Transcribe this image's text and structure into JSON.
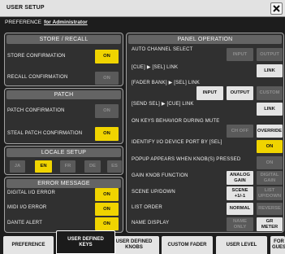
{
  "window": {
    "title": "USER SETUP"
  },
  "icons": {
    "close": "close-icon"
  },
  "colors": {
    "accent_yellow": "#f0d400",
    "active_white": "#e4e4e4",
    "inactive_gray": "#5a5a5a",
    "inactive_text": "#8e8e8e",
    "panel_bg": "#303030",
    "header_bg": "#646464",
    "page_bg": "#1d1d1d",
    "title_bar": "#e2e2e2"
  },
  "preference": {
    "heading": "PREFERENCE",
    "user": "for Administrator"
  },
  "store_recall": {
    "header": "STORE / RECALL",
    "rows": [
      {
        "label": "STORE CONFIRMATION",
        "value": "ON",
        "active": true
      },
      {
        "label": "RECALL CONFIRMATION",
        "value": "ON",
        "active": false
      }
    ]
  },
  "patch": {
    "header": "PATCH",
    "rows": [
      {
        "label": "PATCH CONFIRMATION",
        "value": "ON",
        "active": false
      },
      {
        "label": "STEAL PATCH CONFIRMATION",
        "value": "ON",
        "active": true
      }
    ]
  },
  "locale": {
    "header": "LOCALE SETUP",
    "options": [
      {
        "label": "JA",
        "selected": false
      },
      {
        "label": "EN",
        "selected": true
      },
      {
        "label": "FR",
        "selected": false
      },
      {
        "label": "DE",
        "selected": false
      },
      {
        "label": "ES",
        "selected": false
      }
    ]
  },
  "error_message": {
    "header": "ERROR MESSAGE",
    "rows": [
      {
        "label": "DIGITAL I/O ERROR",
        "value": "ON",
        "active": true
      },
      {
        "label": "MIDI I/O ERROR",
        "value": "ON",
        "active": true
      },
      {
        "label": "DANTE ALERT",
        "value": "ON",
        "active": true
      }
    ]
  },
  "panel_operation": {
    "header": "PANEL OPERATION",
    "rows": [
      {
        "label": "AUTO CHANNEL SELECT",
        "options": [
          {
            "label": "INPUT",
            "active": false
          },
          {
            "label": "OUTPUT",
            "active": false
          }
        ]
      },
      {
        "label": "[CUE] ▶ [SEL] LINK",
        "options": [
          {
            "label": "LINK",
            "active": true
          }
        ]
      },
      {
        "label": "[FADER BANK] ▶ [SEL] LINK",
        "options": [
          {
            "label": "INPUT",
            "active": true
          },
          {
            "label": "OUTPUT",
            "active": true
          },
          {
            "label": "CUSTOM",
            "active": false
          }
        ]
      },
      {
        "label": "[SEND SEL] ▶ [CUE] LINK",
        "options": [
          {
            "label": "LINK",
            "active": true
          }
        ]
      },
      {
        "label": "ON KEYS BEHAVIOR DURING MUTE",
        "options": [
          {
            "label": "CH OFF",
            "active": false
          },
          {
            "label": "OVERRIDE",
            "active": true
          }
        ]
      },
      {
        "label": "IDENTIFY I/O DEVICE PORT BY [SEL]",
        "options": [
          {
            "label": "ON",
            "active": true
          }
        ]
      },
      {
        "label": "POPUP APPEARS WHEN KNOB(S) PRESSED",
        "options": [
          {
            "label": "ON",
            "active": false
          }
        ]
      },
      {
        "label": "GAIN KNOB FUNCTION",
        "options": [
          {
            "label": "ANALOG\nGAIN",
            "active": true
          },
          {
            "label": "DIGITAL\nGAIN",
            "active": false
          }
        ]
      },
      {
        "label": "SCENE UP/DOWN",
        "options": [
          {
            "label": "SCENE\n+1/-1",
            "active": true
          },
          {
            "label": "LIST\nUP/DOWN",
            "active": false
          }
        ]
      },
      {
        "label": "LIST ORDER",
        "options": [
          {
            "label": "NORMAL",
            "active": true
          },
          {
            "label": "REVERSE",
            "active": false
          }
        ]
      },
      {
        "label": "NAME DISPLAY",
        "options": [
          {
            "label": "NAME\nONLY",
            "active": false
          },
          {
            "label": "GR\nMETER",
            "active": true
          }
        ]
      }
    ]
  },
  "tabs": [
    {
      "label": "PREFERENCE",
      "selected": false
    },
    {
      "label": "USER DEFINED\nKEYS",
      "selected": true
    },
    {
      "label": "USER DEFINED\nKNOBS",
      "selected": false
    },
    {
      "label": "CUSTOM FADER",
      "selected": false
    },
    {
      "label": "USER LEVEL",
      "selected": false
    },
    {
      "label": "FOR\nGUES",
      "selected": false
    }
  ]
}
